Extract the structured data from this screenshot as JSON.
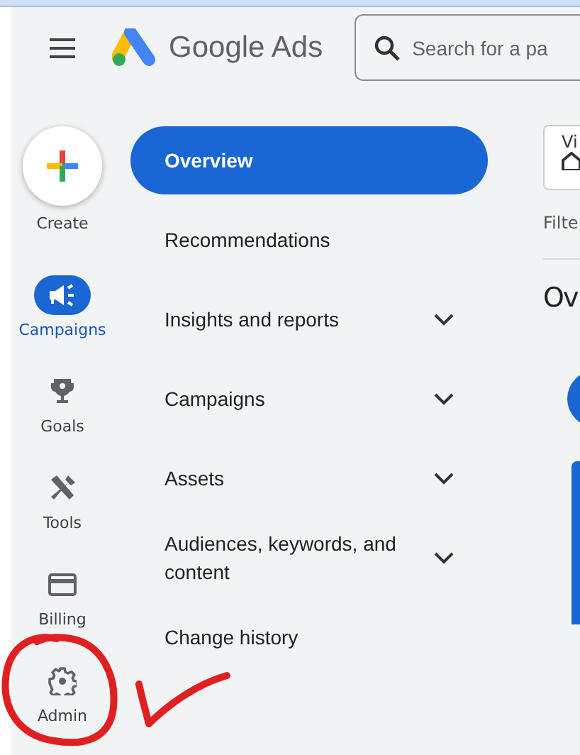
{
  "header": {
    "app_name": "Google Ads",
    "search": {
      "placeholder": "Search for a pa"
    }
  },
  "rail": [
    {
      "label": "Create",
      "kind": "create",
      "selected": false
    },
    {
      "label": "Campaigns",
      "kind": "campaigns",
      "selected": true
    },
    {
      "label": "Goals",
      "kind": "goals",
      "selected": false
    },
    {
      "label": "Tools",
      "kind": "tools",
      "selected": false
    },
    {
      "label": "Billing",
      "kind": "billing",
      "selected": false
    },
    {
      "label": "Admin",
      "kind": "admin",
      "selected": false
    }
  ],
  "nav": [
    {
      "label": "Overview",
      "selected": true,
      "expandable": false
    },
    {
      "label": "Recommendations",
      "selected": false,
      "expandable": false
    },
    {
      "label": "Insights and reports",
      "selected": false,
      "expandable": true
    },
    {
      "label": "Campaigns",
      "selected": false,
      "expandable": true
    },
    {
      "label": "Assets",
      "selected": false,
      "expandable": true
    },
    {
      "label": "Audiences, keywords, and content",
      "selected": false,
      "expandable": true
    },
    {
      "label": "Change history",
      "selected": false,
      "expandable": false
    }
  ],
  "right_panel": {
    "view_card": "Vi",
    "filter_label": "Filte",
    "heading": "Ov"
  }
}
